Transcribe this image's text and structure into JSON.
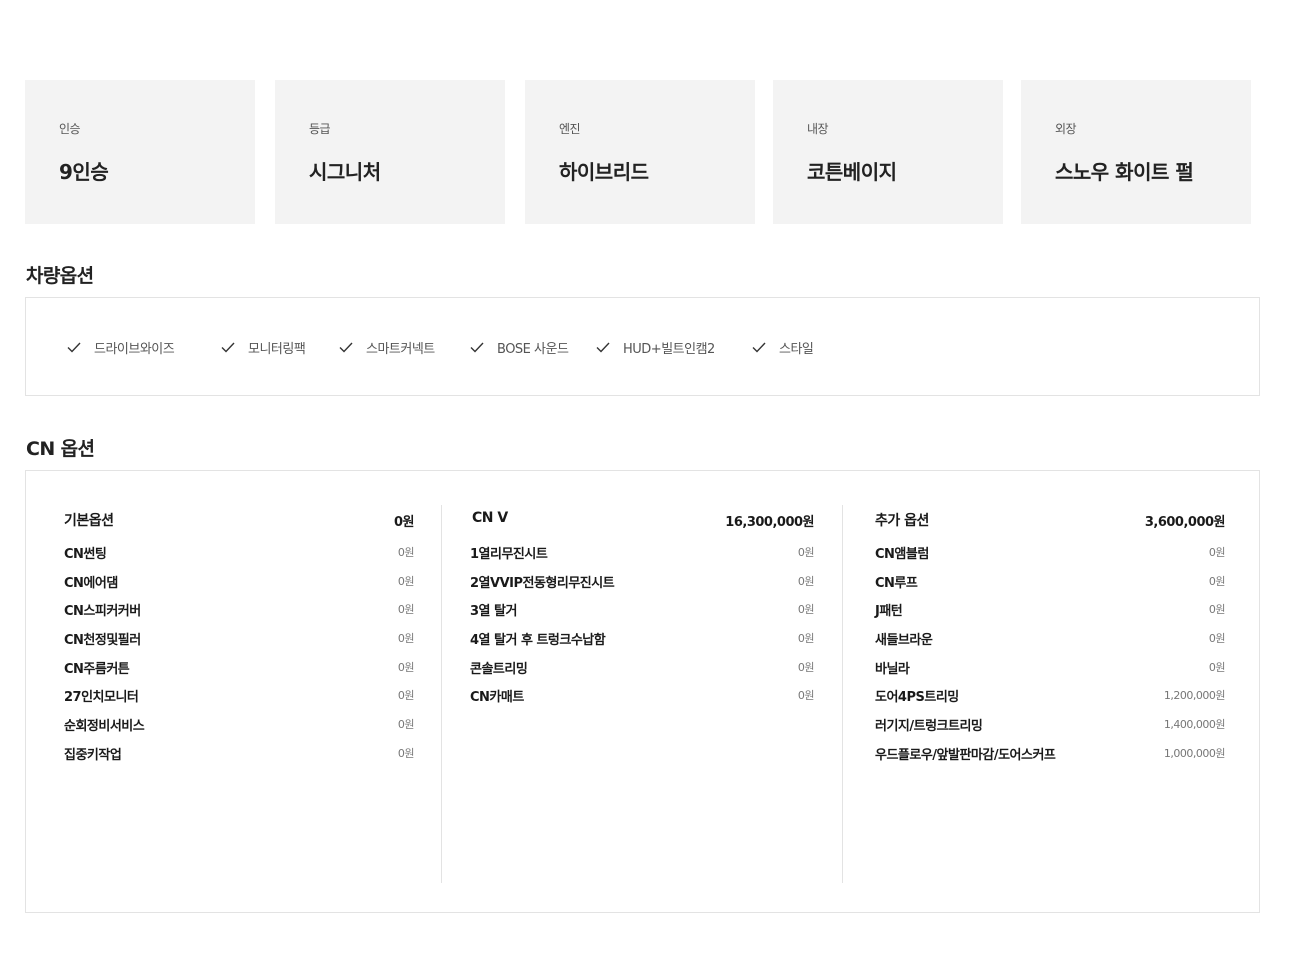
{
  "specs": [
    {
      "label": "인승",
      "value": "9인승"
    },
    {
      "label": "등급",
      "value": "시그니처"
    },
    {
      "label": "엔진",
      "value": "하이브리드"
    },
    {
      "label": "내장",
      "value": "코튼베이지"
    },
    {
      "label": "외장",
      "value": "스노우 화이트 펄"
    }
  ],
  "vehicle_options": {
    "title": "차량옵션",
    "items": [
      "드라이브와이즈",
      "모니터링팩",
      "스마트커넥트",
      "BOSE 사운드",
      "HUD+빌트인캠2",
      "스타일"
    ],
    "icon": "check-icon"
  },
  "cn_options": {
    "title": "CN 옵션",
    "columns": [
      {
        "name": "기본옵션",
        "price": "0원",
        "rows": [
          {
            "name": "CN썬팅",
            "price": "0원"
          },
          {
            "name": "CN에어댐",
            "price": "0원"
          },
          {
            "name": "CN스피커커버",
            "price": "0원"
          },
          {
            "name": "CN천정및필러",
            "price": "0원"
          },
          {
            "name": "CN주름커튼",
            "price": "0원"
          },
          {
            "name": "27인치모니터",
            "price": "0원"
          },
          {
            "name": "순회정비서비스",
            "price": "0원"
          },
          {
            "name": "집중키작업",
            "price": "0원"
          }
        ]
      },
      {
        "name": "CN V",
        "price": "16,300,000원",
        "rows": [
          {
            "name": "1열리무진시트",
            "price": "0원"
          },
          {
            "name": "2열VVIP전동형리무진시트",
            "price": "0원"
          },
          {
            "name": "3열 탈거",
            "price": "0원"
          },
          {
            "name": "4열 탈거 후 트렁크수납함",
            "price": "0원"
          },
          {
            "name": "콘솔트리밍",
            "price": "0원"
          },
          {
            "name": "CN카매트",
            "price": "0원"
          }
        ]
      },
      {
        "name": "추가 옵션",
        "price": "3,600,000원",
        "rows": [
          {
            "name": "CN앰블럼",
            "price": "0원"
          },
          {
            "name": "CN루프",
            "price": "0원"
          },
          {
            "name": "J패턴",
            "price": "0원"
          },
          {
            "name": "새들브라운",
            "price": "0원"
          },
          {
            "name": "바닐라",
            "price": "0원"
          },
          {
            "name": "도어4PS트리밍",
            "price": "1,200,000원"
          },
          {
            "name": "러기지/트렁크트리밍",
            "price": "1,400,000원"
          },
          {
            "name": "우드플로우/앞발판마감/도어스커프",
            "price": "1,000,000원"
          }
        ]
      }
    ]
  }
}
